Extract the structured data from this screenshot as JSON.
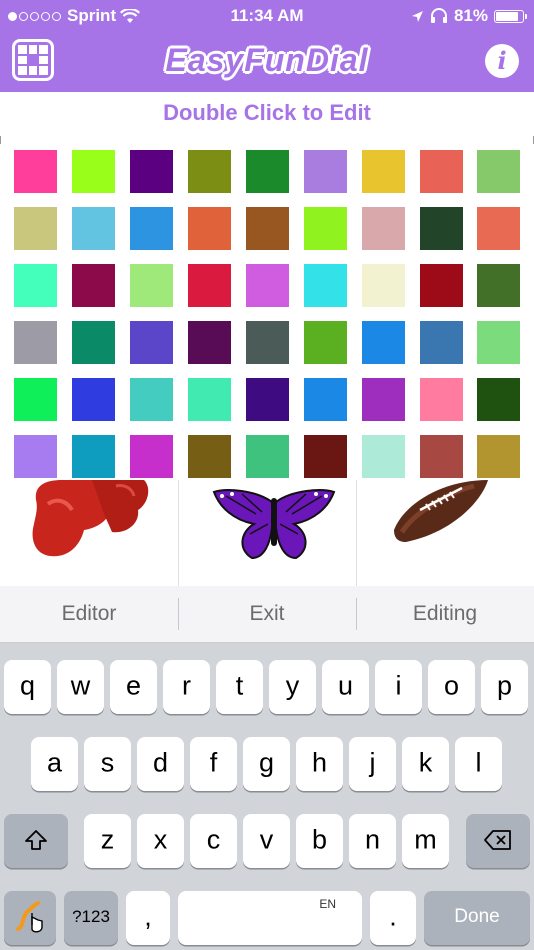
{
  "status": {
    "carrier": "Sprint",
    "time": "11:34 AM",
    "battery": "81%",
    "battery_level": 0.81,
    "signal_bars_filled": 1,
    "signal_bars_total": 5
  },
  "header": {
    "title": "EasyFunDial",
    "info_label": "i"
  },
  "subtitle": "Double Click to Edit",
  "palette": {
    "rows": [
      [
        "#ff3d9a",
        "#99ff1a",
        "#5b0080",
        "#7c8f14",
        "#1a8a2a",
        "#a97de0",
        "#e8c52e",
        "#e86255",
        "#86c96b"
      ],
      [
        "#c9c77e",
        "#62c4e0",
        "#2d94e2",
        "#e0623a",
        "#985720",
        "#90f21f",
        "#d8a8aa",
        "#22452a",
        "#e86a52"
      ],
      [
        "#44ffbc",
        "#8c0a4a",
        "#9fe87a",
        "#db1a3f",
        "#d05ce0",
        "#32e2e8",
        "#f2f2d0",
        "#9c0b17",
        "#437029"
      ],
      [
        "#9d9ca6",
        "#0a8a66",
        "#5b45c9",
        "#570c55",
        "#4a5b58",
        "#5ab020",
        "#1c88e6",
        "#3a76b0",
        "#7cdb7c"
      ],
      [
        "#0fef5a",
        "#2e3ce0",
        "#44ccc0",
        "#40eab0",
        "#3e0c80",
        "#1c88e6",
        "#9e2ebd",
        "#ff7ba0",
        "#1f5210"
      ],
      [
        "#a77cf0",
        "#0e9cbf",
        "#c72fcc",
        "#765f14",
        "#40c27f",
        "#6a1612",
        "#aeead8",
        "#a84842",
        "#b39530"
      ]
    ]
  },
  "images": [
    {
      "name": "boxing-gloves"
    },
    {
      "name": "butterfly"
    },
    {
      "name": "football"
    }
  ],
  "suggestions": [
    "Editor",
    "Exit",
    "Editing"
  ],
  "keyboard": {
    "row1": [
      "q",
      "w",
      "e",
      "r",
      "t",
      "y",
      "u",
      "i",
      "o",
      "p"
    ],
    "row2": [
      "a",
      "s",
      "d",
      "f",
      "g",
      "h",
      "j",
      "k",
      "l"
    ],
    "row3": [
      "z",
      "x",
      "c",
      "v",
      "b",
      "n",
      "m"
    ],
    "numbers_label": "?123",
    "comma": ",",
    "space_sub": "EN",
    "period": ".",
    "done_label": "Done"
  },
  "colors": {
    "accent": "#a774e8"
  }
}
